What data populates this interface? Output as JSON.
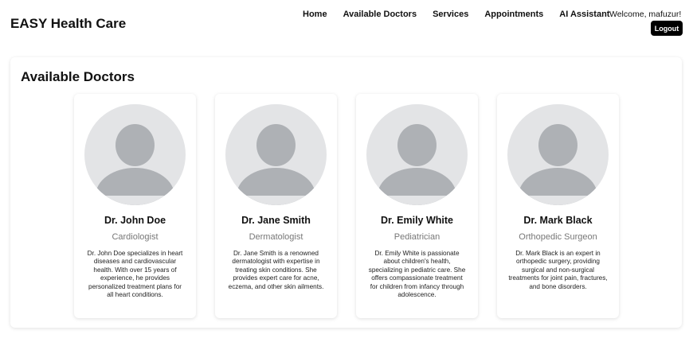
{
  "header": {
    "brand": "EASY Health Care",
    "nav": [
      "Home",
      "Available Doctors",
      "Services",
      "Appointments",
      "AI Assistant"
    ],
    "welcome": "Welcome, mafuzur!",
    "logout": "Logout"
  },
  "main": {
    "title": "Available Doctors",
    "doctors": [
      {
        "name": "Dr. John Doe",
        "specialty": "Cardiologist",
        "description": "Dr. John Doe specializes in heart diseases and cardiovascular health. With over 15 years of experience, he provides personalized treatment plans for all heart conditions."
      },
      {
        "name": "Dr. Jane Smith",
        "specialty": "Dermatologist",
        "description": "Dr. Jane Smith is a renowned dermatologist with expertise in treating skin conditions. She provides expert care for acne, eczema, and other skin ailments."
      },
      {
        "name": "Dr. Emily White",
        "specialty": "Pediatrician",
        "description": "Dr. Emily White is passionate about children's health, specializing in pediatric care. She offers compassionate treatment for children from infancy through adolescence."
      },
      {
        "name": "Dr. Mark Black",
        "specialty": "Orthopedic Surgeon",
        "description": "Dr. Mark Black is an expert in orthopedic surgery, providing surgical and non-surgical treatments for joint pain, fractures, and bone disorders."
      }
    ]
  }
}
